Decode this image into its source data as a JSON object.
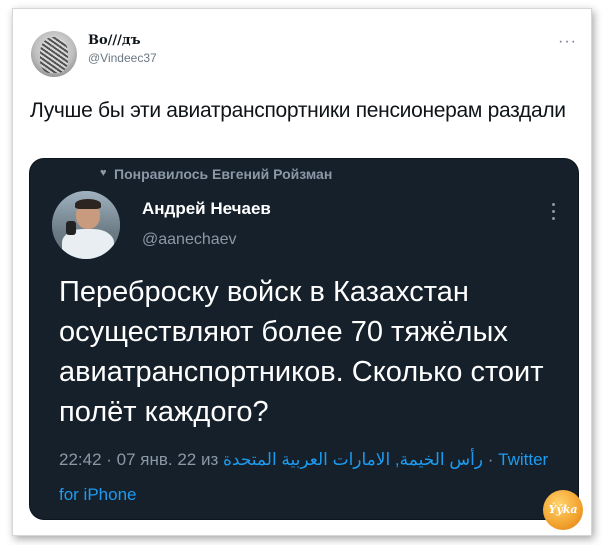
{
  "author": {
    "name": "Во///дъ",
    "handle": "@Vindeec37",
    "more_icon": "more-horizontal-icon"
  },
  "tweet": {
    "text": "Лучше бы эти авиатранспортники пенсионерам раздали"
  },
  "quote": {
    "liked_by": "Понравилось Евгений Ройзман",
    "name": "Андрей Нечаев",
    "handle": "@aanechaev",
    "text": "Переброску войск в Казахстан осуществляют более 70 тяжёлых авиатранспортников. Сколько стоит полёт каждого?",
    "time": "22:42 · 07 янв. 22 из ",
    "location": "رأس الخيمة, الامارات العربية المتحدة",
    "sep": " · ",
    "client": "Twitter for iPhone"
  },
  "colors": {
    "card_bg": "#15202b",
    "link_blue": "#1d9bf0",
    "muted": "#8b98a5"
  },
  "watermark": {
    "label": "Ýýka"
  }
}
